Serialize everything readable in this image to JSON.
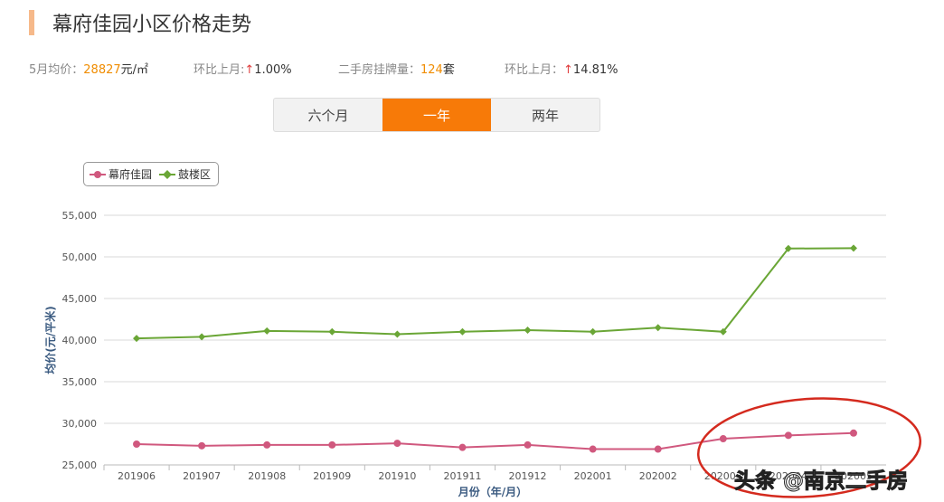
{
  "header": {
    "title": "幕府佳园小区价格走势"
  },
  "stats": {
    "avg_label": "5月均价：",
    "avg_value": "28827",
    "avg_unit": "元/㎡",
    "mom1_label": "环比上月:",
    "mom1_arrow": "↑",
    "mom1_value": "1.00%",
    "listing_label": "二手房挂牌量：",
    "listing_value": "124",
    "listing_unit": "套",
    "mom2_label": "环比上月：",
    "mom2_arrow": "↑",
    "mom2_value": "14.81%"
  },
  "tabs": [
    {
      "label": "六个月"
    },
    {
      "label": "一年",
      "active": true
    },
    {
      "label": "两年"
    }
  ],
  "watermark": "头条 @南京二手房",
  "chart_data": {
    "type": "line",
    "xlabel": "月份（年/月）",
    "ylabel": "均价(元/平米)",
    "ylim": [
      25000,
      55000
    ],
    "yticks": [
      "25,000",
      "30,000",
      "35,000",
      "40,000",
      "45,000",
      "50,000",
      "55,000"
    ],
    "categories": [
      "201906",
      "201907",
      "201908",
      "201909",
      "201910",
      "201911",
      "201912",
      "202001",
      "202002",
      "202003",
      "202004",
      "202005"
    ],
    "legend_position": "top-left",
    "series": [
      {
        "name": "幕府佳园",
        "color": "#d0587e",
        "values": [
          27500,
          27300,
          27400,
          27400,
          27600,
          27100,
          27400,
          26900,
          26900,
          28150,
          28550,
          28827
        ]
      },
      {
        "name": "鼓楼区",
        "color": "#6aa636",
        "values": [
          40200,
          40400,
          41100,
          41000,
          40700,
          41000,
          41200,
          41000,
          41500,
          41000,
          51000,
          51050
        ]
      }
    ]
  }
}
